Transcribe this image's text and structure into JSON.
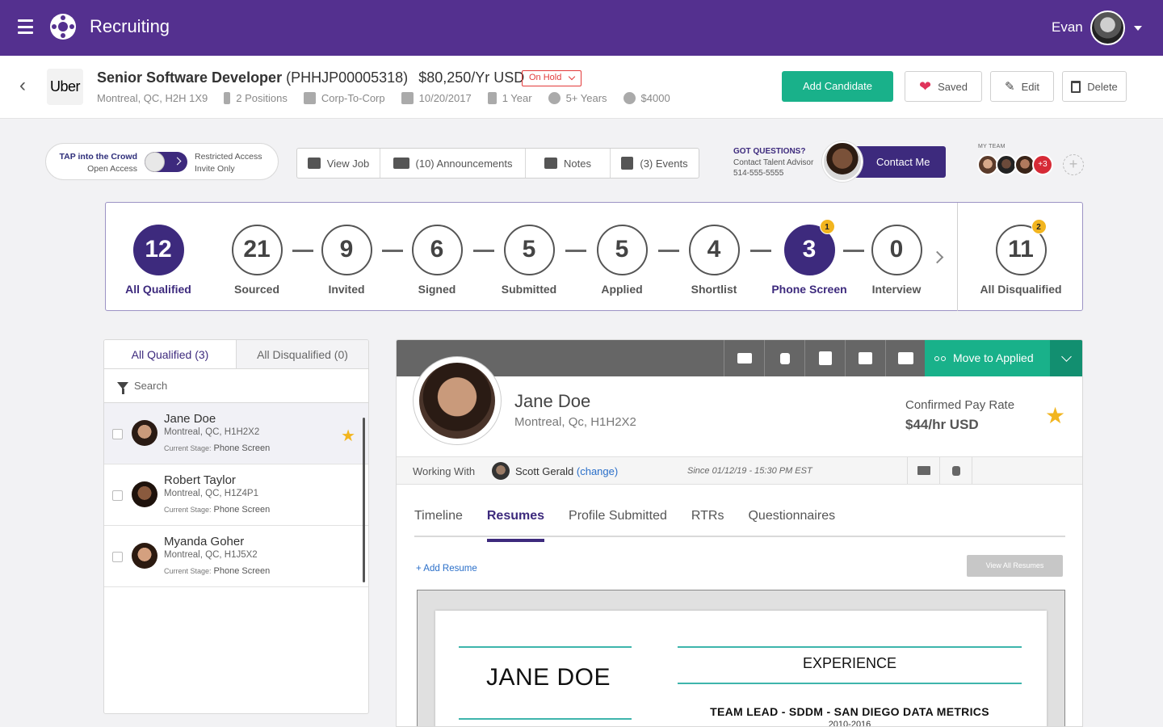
{
  "app": {
    "title": "Recruiting",
    "user_name": "Evan"
  },
  "colors": {
    "brand": "#54308f",
    "accent": "#3d2a7d",
    "success": "#19b18a",
    "danger": "#e23a3a",
    "star": "#f2b51f"
  },
  "job": {
    "company_logo": "Uber",
    "title": "Senior Software Developer",
    "id": "(PHHJP00005318)",
    "salary": "$80,250/Yr USD",
    "status": "On Hold",
    "location": "Montreal, QC, H2H 1X9",
    "positions": "2 Positions",
    "type": "Corp-To-Corp",
    "date": "10/20/2017",
    "duration": "1 Year",
    "experience": "5+ Years",
    "fee": "$4000"
  },
  "actions": {
    "add_candidate": "Add Candidate",
    "saved": "Saved",
    "edit": "Edit",
    "delete": "Delete"
  },
  "access": {
    "left_title": "TAP into the Crowd",
    "left_sub": "Open Access",
    "right_title": "Restricted Access",
    "right_sub": "Invite Only"
  },
  "toolbar": {
    "view_job": "View Job",
    "announcements": "(10) Announcements",
    "notes": "Notes",
    "events": "(3) Events"
  },
  "advisor": {
    "q1": "GOT QUESTIONS?",
    "q2": "Contact Talent Advisor",
    "phone": "514-555-5555",
    "contact": "Contact Me"
  },
  "team": {
    "label": "MY TEAM",
    "more": "+3"
  },
  "pipeline": {
    "stages": [
      {
        "count": "12",
        "label": "All Qualified",
        "active": true
      },
      {
        "count": "21",
        "label": "Sourced"
      },
      {
        "count": "9",
        "label": "Invited"
      },
      {
        "count": "6",
        "label": "Signed"
      },
      {
        "count": "5",
        "label": "Submitted"
      },
      {
        "count": "5",
        "label": "Applied"
      },
      {
        "count": "4",
        "label": "Shortlist"
      },
      {
        "count": "3",
        "label": "Phone Screen",
        "active": true,
        "badge": "1"
      },
      {
        "count": "0",
        "label": "Interview"
      },
      {
        "count": "11",
        "label": "All Disqualified",
        "badge": "2"
      }
    ]
  },
  "candidates": {
    "tabs": [
      "All Qualified (3)",
      "All Disqualified (0)"
    ],
    "search_label": "Search",
    "stage_prefix": "Current Stage:",
    "items": [
      {
        "name": "Jane Doe",
        "location": "Montreal, QC, H1H2X2",
        "stage": "Phone Screen",
        "starred": true
      },
      {
        "name": "Robert Taylor",
        "location": "Montreal, QC, H1Z4P1",
        "stage": "Phone Screen"
      },
      {
        "name": "Myanda Goher",
        "location": "Montreal, QC, H1J5X2",
        "stage": "Phone Screen"
      }
    ]
  },
  "detail": {
    "move_label": "Move to Applied",
    "name": "Jane Doe",
    "location": "Montreal, Qc, H1H2X2",
    "pay_label": "Confirmed Pay Rate",
    "pay_value": "$44/hr USD",
    "working_label": "Working With",
    "working_name": "Scott Gerald",
    "working_change": "(change)",
    "since": "Since 01/12/19 - 15:30 PM EST",
    "tabs": [
      "Timeline",
      "Resumes",
      "Profile Submitted",
      "RTRs",
      "Questionnaires"
    ],
    "active_tab": "Resumes",
    "add_resume": "+ Add Resume",
    "view_all": "View All Resumes",
    "resume": {
      "name": "JANE DOE",
      "section": "EXPERIENCE",
      "role": "TEAM LEAD - SDDM - SAN DIEGO DATA METRICS",
      "dates": "2010-2016"
    }
  }
}
